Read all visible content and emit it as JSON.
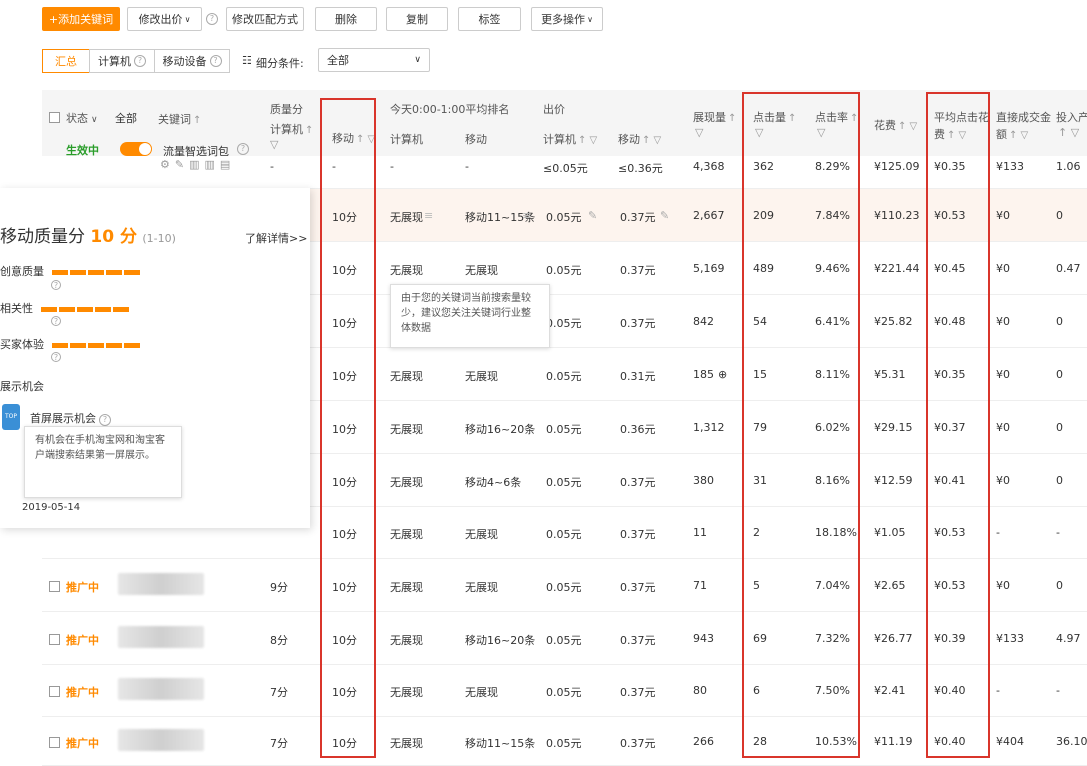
{
  "toolbar": {
    "add_keyword": "+添加关键词",
    "modify_bid": "修改出价",
    "modify_match": "修改匹配方式",
    "delete": "删除",
    "copy": "复制",
    "tag": "标签",
    "more_ops": "更多操作"
  },
  "filters": {
    "summary": "汇总",
    "computer": "计算机",
    "mobile": "移动设备",
    "detail_label": "细分条件:",
    "select_value": "全部"
  },
  "header": {
    "status": "状态",
    "all": "全部",
    "keyword": "关键词",
    "quality_score": "质量分",
    "qs_computer": "计算机",
    "qs_mobile": "移动",
    "rank_title": "今天0:00-1:00平均排名",
    "rank_computer": "计算机",
    "rank_mobile": "移动",
    "bid": "出价",
    "bid_computer": "计算机",
    "bid_mobile": "移动",
    "impressions": "展现量",
    "clicks": "点击量",
    "ctr": "点击率",
    "cost": "花费",
    "avg_cpc_1": "平均点击花",
    "avg_cpc_2": "费",
    "direct_gmv_1": "直接成交金",
    "direct_gmv_2": "额",
    "roi": "投入产"
  },
  "pkg_row": {
    "status": "生效中",
    "name": "流量智选词包",
    "qs_pc": "-",
    "qs_mobile": "-",
    "rank_pc": "-",
    "rank_mobile": "-",
    "bid_pc": "≤0.05元",
    "bid_mobile": "≤0.36元",
    "impressions": "4,368",
    "clicks": "362",
    "ctr": "8.29%",
    "cost": "¥125.09",
    "cpc": "¥0.35",
    "gmv": "¥133",
    "roi": "1.06"
  },
  "rows": [
    {
      "status": "",
      "qs_pc": "",
      "qs_m": "10分",
      "rank_pc": "无展现",
      "rank_m": "移动11~15条",
      "bid_pc": "0.05元",
      "bid_m": "0.37元",
      "imp": "2,667",
      "clk": "209",
      "ctr": "7.84%",
      "cost": "¥110.23",
      "cpc": "¥0.53",
      "gmv": "¥0",
      "roi": "0"
    },
    {
      "status": "",
      "qs_pc": "",
      "qs_m": "10分",
      "rank_pc": "无展现",
      "rank_m": "无展现",
      "bid_pc": "0.05元",
      "bid_m": "0.37元",
      "imp": "5,169",
      "clk": "489",
      "ctr": "9.46%",
      "cost": "¥221.44",
      "cpc": "¥0.45",
      "gmv": "¥0",
      "roi": "0.47"
    },
    {
      "status": "",
      "qs_pc": "",
      "qs_m": "10分",
      "rank_pc": "",
      "rank_m": "",
      "bid_pc": "0.05元",
      "bid_m": "0.37元",
      "imp": "842",
      "clk": "54",
      "ctr": "6.41%",
      "cost": "¥25.82",
      "cpc": "¥0.48",
      "gmv": "¥0",
      "roi": "0"
    },
    {
      "status": "",
      "qs_pc": "",
      "qs_m": "10分",
      "rank_pc": "无展现",
      "rank_m": "无展现",
      "bid_pc": "0.05元",
      "bid_m": "0.31元",
      "imp": "185",
      "clk": "15",
      "ctr": "8.11%",
      "cost": "¥5.31",
      "cpc": "¥0.35",
      "gmv": "¥0",
      "roi": "0"
    },
    {
      "status": "",
      "qs_pc": "",
      "qs_m": "10分",
      "rank_pc": "无展现",
      "rank_m": "移动16~20条",
      "bid_pc": "0.05元",
      "bid_m": "0.36元",
      "imp": "1,312",
      "clk": "79",
      "ctr": "6.02%",
      "cost": "¥29.15",
      "cpc": "¥0.37",
      "gmv": "¥0",
      "roi": "0"
    },
    {
      "status": "",
      "qs_pc": "",
      "qs_m": "10分",
      "rank_pc": "无展现",
      "rank_m": "移动4~6条",
      "bid_pc": "0.05元",
      "bid_m": "0.37元",
      "imp": "380",
      "clk": "31",
      "ctr": "8.16%",
      "cost": "¥12.59",
      "cpc": "¥0.41",
      "gmv": "¥0",
      "roi": "0"
    },
    {
      "status": "",
      "qs_pc": "",
      "qs_m": "10分",
      "rank_pc": "无展现",
      "rank_m": "无展现",
      "bid_pc": "0.05元",
      "bid_m": "0.37元",
      "imp": "11",
      "clk": "2",
      "ctr": "18.18%",
      "cost": "¥1.05",
      "cpc": "¥0.53",
      "gmv": "-",
      "roi": "-"
    },
    {
      "status": "推广中",
      "qs_pc": "9分",
      "qs_m": "10分",
      "rank_pc": "无展现",
      "rank_m": "无展现",
      "bid_pc": "0.05元",
      "bid_m": "0.37元",
      "imp": "71",
      "clk": "5",
      "ctr": "7.04%",
      "cost": "¥2.65",
      "cpc": "¥0.53",
      "gmv": "¥0",
      "roi": "0"
    },
    {
      "status": "推广中",
      "qs_pc": "8分",
      "qs_m": "10分",
      "rank_pc": "无展现",
      "rank_m": "移动16~20条",
      "bid_pc": "0.05元",
      "bid_m": "0.37元",
      "imp": "943",
      "clk": "69",
      "ctr": "7.32%",
      "cost": "¥26.77",
      "cpc": "¥0.39",
      "gmv": "¥133",
      "roi": "4.97"
    },
    {
      "status": "推广中",
      "qs_pc": "7分",
      "qs_m": "10分",
      "rank_pc": "无展现",
      "rank_m": "无展现",
      "bid_pc": "0.05元",
      "bid_m": "0.37元",
      "imp": "80",
      "clk": "6",
      "ctr": "7.50%",
      "cost": "¥2.41",
      "cpc": "¥0.40",
      "gmv": "-",
      "roi": "-"
    },
    {
      "status": "推广中",
      "qs_pc": "7分",
      "qs_m": "10分",
      "rank_pc": "无展现",
      "rank_m": "移动11~15条",
      "bid_pc": "0.05元",
      "bid_m": "0.37元",
      "imp": "266",
      "clk": "28",
      "ctr": "10.53%",
      "cost": "¥11.19",
      "cpc": "¥0.40",
      "gmv": "¥404",
      "roi": "36.10"
    }
  ],
  "tooltip_rank": "由于您的关键词当前搜索量较少，建议您关注关键词行业整体数据",
  "panel": {
    "title": "移动质量分",
    "score": "10 分",
    "range": "(1-10)",
    "learn_more": "了解详情>>",
    "items": [
      "创意质量",
      "相关性",
      "买家体验"
    ],
    "show_chance": "展示机会",
    "first_screen": "首屏展示机会",
    "first_screen_tip": "有机会在手机淘宝网和淘宝客户端搜索结果第一屏展示。",
    "date": "2019-05-14",
    "top_badge": "TOP"
  }
}
